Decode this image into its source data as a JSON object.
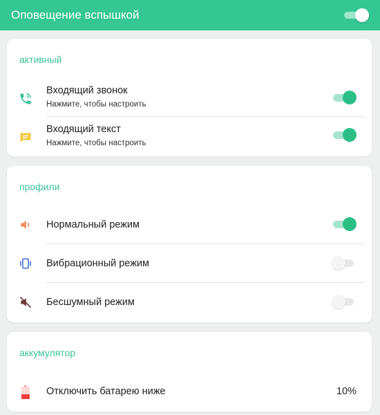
{
  "appbar": {
    "title": "Оповещение вспышкой",
    "master_switch_on": true
  },
  "active": {
    "section_title": "активный",
    "items": [
      {
        "label": "Входящий звонок",
        "sub": "Нажмите, чтобы настроить",
        "icon": "phone-call-icon",
        "enabled": true
      },
      {
        "label": "Входящий текст",
        "sub": "Нажмите, чтобы настроить",
        "icon": "message-icon",
        "enabled": true
      }
    ]
  },
  "profiles": {
    "section_title": "профили",
    "items": [
      {
        "label": "Нормальный режим",
        "icon": "speaker-icon",
        "enabled": true
      },
      {
        "label": "Вибрационный режим",
        "icon": "vibration-icon",
        "enabled": false
      },
      {
        "label": "Бесшумный режим",
        "icon": "mute-icon",
        "enabled": false
      }
    ]
  },
  "battery": {
    "section_title": "аккумулятор",
    "label": "Отключить батарею ниже",
    "value": "10%",
    "icon": "battery-low-icon"
  },
  "colors": {
    "accent": "#34c794",
    "switch_on": "#2bbf86",
    "call_icon": "#36c29a",
    "message_icon": "#f3c73e",
    "speaker_icon": "#f08a5d",
    "vibration_icon": "#4a74d8",
    "mute_icon": "#6b3b3b",
    "battery_icon": "#ef3f3f"
  }
}
